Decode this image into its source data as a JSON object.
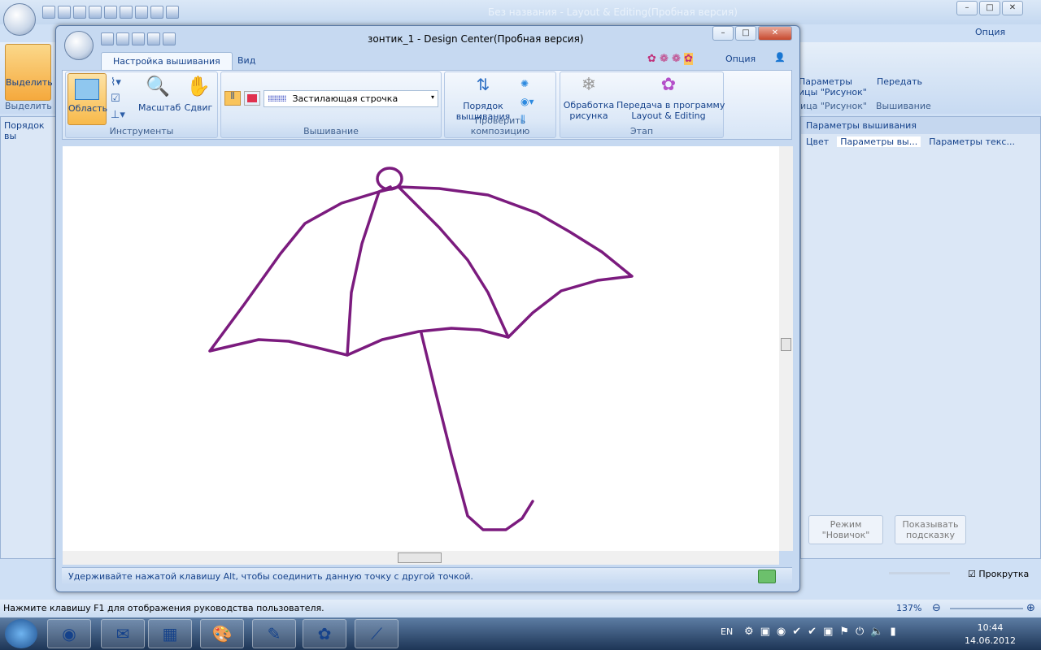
{
  "background_app": {
    "title": "Без названия - Layout & Editing(Пробная версия)",
    "option": "Опция",
    "select_label": "Выделить",
    "select_group": "Выделить",
    "params_label": "Параметры\nицы \"Рисунок\"",
    "params_group": "ица \"Рисунок\"",
    "transfer_label": "Передать",
    "transfer_group": "Вышивание",
    "left_panel_title": "Порядок вы",
    "right_panel_title": "Параметры вышивания",
    "right_tabs": [
      "Цвет",
      "Параметры вы...",
      "Параметры текс..."
    ],
    "novice_button": "Режим\n\"Новичок\"",
    "hint_button": "Показывать\nподсказку",
    "scroll_checkbox": "Прокрутка",
    "scroll_checked": true,
    "status_text": "Нажмите клавишу F1 для отображения руководства пользователя.",
    "zoom": "137%"
  },
  "dialog": {
    "title": "зонтик_1 - Design Center(Пробная версия)",
    "tabs": [
      "Настройка вышивания",
      "Вид"
    ],
    "option": "Опция",
    "groups": {
      "tools": "Инструменты",
      "embroidery": "Вышивание",
      "check": "Проверить композицию",
      "stage": "Этап"
    },
    "buttons": {
      "area": "Область",
      "zoom": "Масштаб",
      "pan": "Сдвиг",
      "order": "Порядок\nвышивания",
      "process": "Обработка\nрисунка",
      "transfer": "Передача в программу\nLayout & Editing"
    },
    "stitch_select": "Застилающая строчка",
    "status": "Удерживайте нажатой клавишу Alt, чтобы соединить данную точку с другой точкой."
  },
  "taskbar": {
    "time": "10:44",
    "date": "14.06.2012",
    "lang": "EN"
  },
  "colors": {
    "stroke": "#7b1b7e",
    "accent": "#f9c45c"
  }
}
